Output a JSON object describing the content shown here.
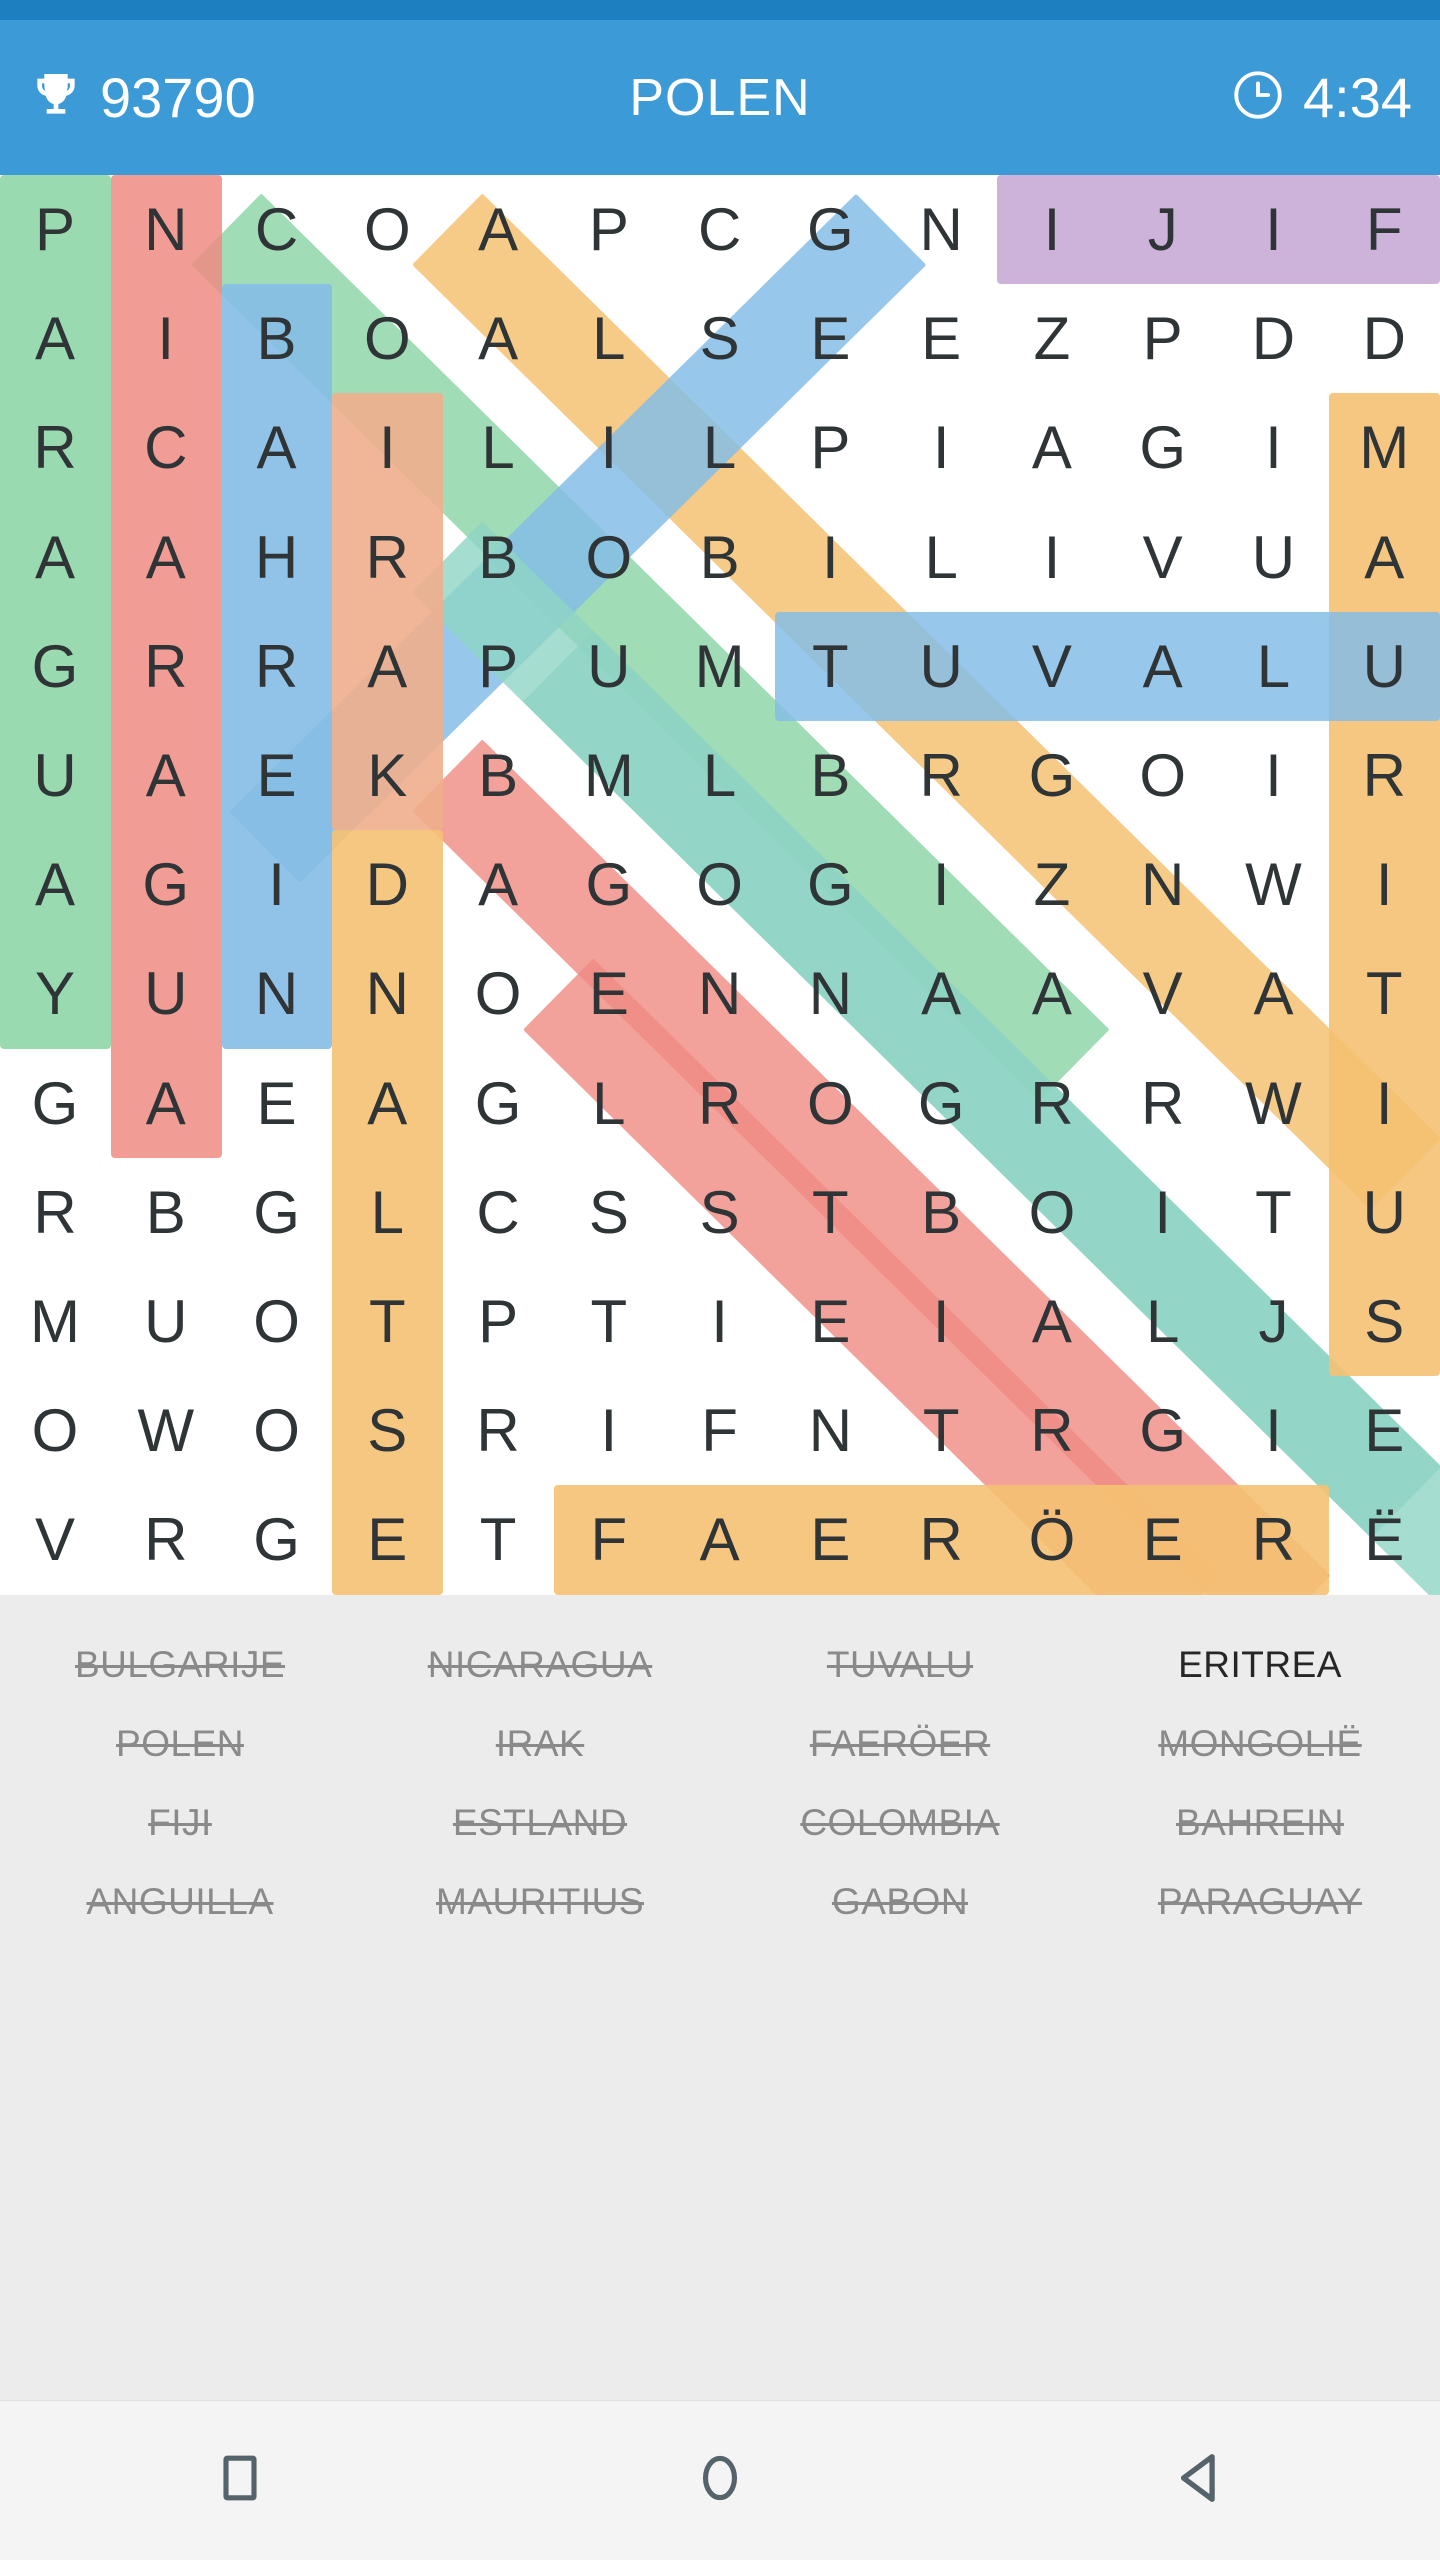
{
  "app": {
    "name": "word-search-game",
    "status_bar_color": "#1d7fc0",
    "top_bar_color": "#3c9ad6"
  },
  "topbar": {
    "trophy_icon": "trophy-icon",
    "score": "93790",
    "title": "POLEN",
    "clock_icon": "clock-icon",
    "timer": "4:34"
  },
  "grid": {
    "rows": 13,
    "cols": 13,
    "letters": [
      [
        "P",
        "N",
        "C",
        "O",
        "A",
        "P",
        "C",
        "G",
        "N",
        "I",
        "J",
        "I",
        "F"
      ],
      [
        "A",
        "I",
        "B",
        "O",
        "A",
        "L",
        "S",
        "E",
        "E",
        "Z",
        "P",
        "D",
        "D"
      ],
      [
        "R",
        "C",
        "A",
        "I",
        "L",
        "I",
        "L",
        "P",
        "I",
        "A",
        "G",
        "I",
        "M"
      ],
      [
        "A",
        "A",
        "H",
        "R",
        "B",
        "O",
        "B",
        "I",
        "L",
        "I",
        "V",
        "U",
        "A"
      ],
      [
        "G",
        "R",
        "R",
        "A",
        "P",
        "U",
        "M",
        "T",
        "U",
        "V",
        "A",
        "L",
        "U"
      ],
      [
        "U",
        "A",
        "E",
        "K",
        "B",
        "M",
        "L",
        "B",
        "R",
        "G",
        "O",
        "I",
        "R"
      ],
      [
        "A",
        "G",
        "I",
        "D",
        "A",
        "G",
        "O",
        "G",
        "I",
        "Z",
        "N",
        "W",
        "I"
      ],
      [
        "Y",
        "U",
        "N",
        "N",
        "O",
        "E",
        "N",
        "N",
        "A",
        "A",
        "V",
        "A",
        "T"
      ],
      [
        "G",
        "A",
        "E",
        "A",
        "G",
        "L",
        "R",
        "O",
        "G",
        "R",
        "R",
        "W",
        "I"
      ],
      [
        "R",
        "B",
        "G",
        "L",
        "C",
        "S",
        "S",
        "T",
        "B",
        "O",
        "I",
        "T",
        "U"
      ],
      [
        "M",
        "U",
        "O",
        "T",
        "P",
        "T",
        "I",
        "E",
        "I",
        "A",
        "L",
        "J",
        "S"
      ],
      [
        "O",
        "W",
        "O",
        "S",
        "R",
        "I",
        "F",
        "N",
        "T",
        "R",
        "G",
        "I",
        "E"
      ],
      [
        "V",
        "R",
        "G",
        "E",
        "T",
        "F",
        "A",
        "E",
        "R",
        "Ö",
        "E",
        "R",
        "Ë"
      ]
    ]
  },
  "highlights": {
    "colors": {
      "green": "#8fd6a8",
      "red": "#ef8b82",
      "blue": "#85bde6",
      "orange": "#f5c172",
      "salmon": "#efae8c",
      "teal": "#8ed4c4",
      "purple": "#c4a4d3"
    },
    "words": [
      {
        "word": "PARAGUAY",
        "color": "green",
        "orientation": "vertical"
      },
      {
        "word": "NICARAGUA",
        "color": "red",
        "orientation": "vertical"
      },
      {
        "word": "BAHREIN",
        "color": "blue",
        "orientation": "vertical"
      },
      {
        "word": "IRAK",
        "color": "salmon",
        "orientation": "vertical"
      },
      {
        "word": "ESTLAND",
        "color": "orange",
        "orientation": "vertical-reversed"
      },
      {
        "word": "MAURITIUS",
        "color": "orange",
        "orientation": "vertical"
      },
      {
        "word": "FIJI",
        "color": "purple",
        "orientation": "horizontal"
      },
      {
        "word": "TUVALU",
        "color": "blue",
        "orientation": "horizontal"
      },
      {
        "word": "FAERÖER",
        "color": "orange",
        "orientation": "horizontal"
      },
      {
        "word": "COLOMBIA",
        "color": "green",
        "orientation": "diagonal"
      },
      {
        "word": "ANGUILLA",
        "color": "orange",
        "orientation": "diagonal"
      },
      {
        "word": "BULGARIJE",
        "color": "blue",
        "orientation": "diagonal"
      },
      {
        "word": "MONGOLIE",
        "color": "red",
        "orientation": "diagonal"
      },
      {
        "word": "GABON",
        "color": "teal",
        "orientation": "diagonal"
      },
      {
        "word": "POLEN",
        "color": "teal",
        "orientation": "diagonal"
      }
    ]
  },
  "wordlist": [
    {
      "label": "BULGARIJE",
      "found": true
    },
    {
      "label": "NICARAGUA",
      "found": true
    },
    {
      "label": "TUVALU",
      "found": true
    },
    {
      "label": "ERITREA",
      "found": false
    },
    {
      "label": "POLEN",
      "found": true
    },
    {
      "label": "IRAK",
      "found": true
    },
    {
      "label": "FAERÖER",
      "found": true
    },
    {
      "label": "MONGOLIË",
      "found": true
    },
    {
      "label": "FIJI",
      "found": true
    },
    {
      "label": "ESTLAND",
      "found": true
    },
    {
      "label": "COLOMBIA",
      "found": true
    },
    {
      "label": "BAHREIN",
      "found": true
    },
    {
      "label": "ANGUILLA",
      "found": true
    },
    {
      "label": "MAURITIUS",
      "found": true
    },
    {
      "label": "GABON",
      "found": true
    },
    {
      "label": "PARAGUAY",
      "found": true
    }
  ],
  "navbar": {
    "recents_icon": "square-recents-icon",
    "home_icon": "circle-home-icon",
    "back_icon": "triangle-back-icon"
  }
}
